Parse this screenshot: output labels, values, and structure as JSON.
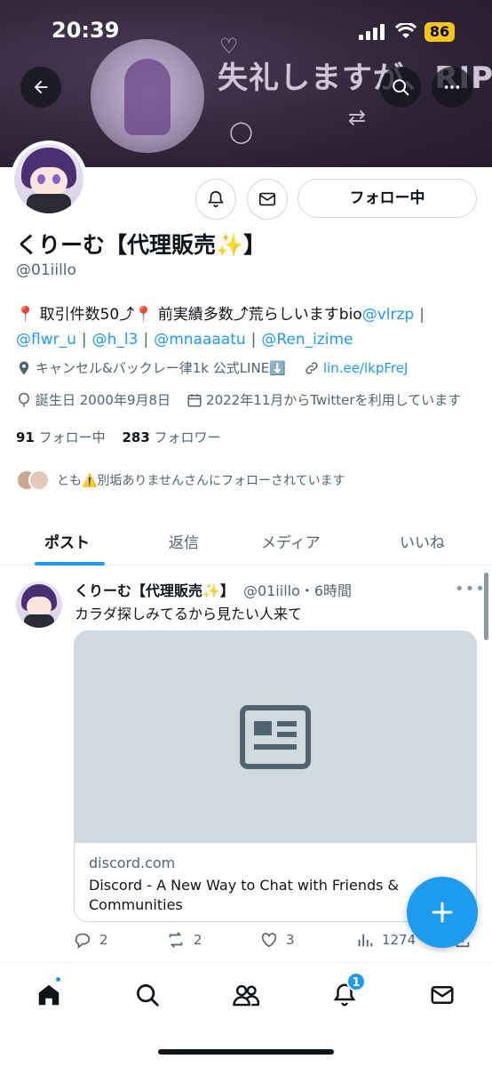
{
  "status_bar": {
    "time": "20:39",
    "battery": "86"
  },
  "banner": {
    "text": "失礼しますが、RIP♡"
  },
  "profile": {
    "follow_button": "フォロー中",
    "name": "くりーむ【代理販売✨】",
    "handle": "@01iillo",
    "bio": {
      "line1_text": "📍 取引件数50⤴︎📍 前実績多数⤴︎荒らしいますbio",
      "line1_link": "@vlrzp",
      "links": [
        "@flwr_u",
        "@h_l3",
        "@mnaaaatu",
        "@Ren_izime"
      ]
    },
    "location": "キャンセル&バックレー律1k 公式LINE⬇️",
    "website": "lin.ee/lkpFreJ",
    "birthday": "誕生日 2000年9月8日",
    "joined": "2022年11月からTwitterを利用しています",
    "following_count": "91",
    "following_label": "フォロー中",
    "followers_count": "283",
    "followers_label": "フォロワー",
    "followed_by": "とも⚠️別垢ありませんさんにフォローされています"
  },
  "tabs": [
    "ポスト",
    "返信",
    "メディア",
    "いいね"
  ],
  "post": {
    "name": "くりーむ【代理販売✨】",
    "handle_time": "@01iillo・6時間",
    "text": "カラダ探しみてるから見たい人来て",
    "card_domain": "discord.com",
    "card_title": "Discord - A New Way to Chat with Friends & Communities",
    "replies": "2",
    "reposts": "2",
    "likes": "3",
    "views": "1274"
  },
  "bottom_nav": {
    "notification_badge": "1"
  },
  "colors": {
    "accent": "#1d9bf0",
    "text": "#0f1419",
    "secondary": "#536471"
  }
}
